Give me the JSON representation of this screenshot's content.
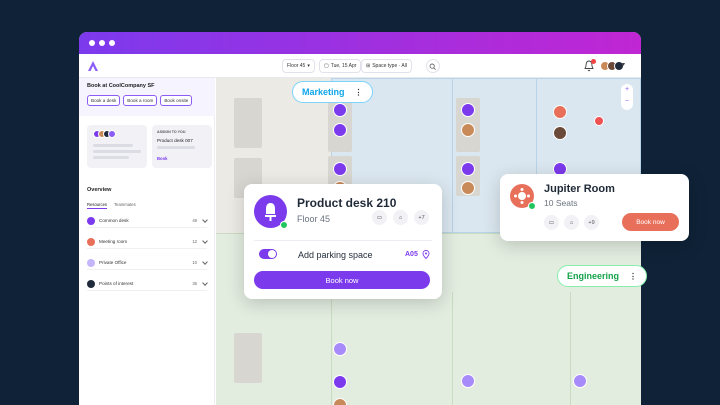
{
  "topbar": {
    "floor_filter": "Floor 45",
    "date_filter": "Tue, 15 Apr",
    "space_filter": "Space type · All"
  },
  "sidebar": {
    "book_title": "Book at CoolCompany SF",
    "buttons": [
      "Book a desk",
      "Book a room",
      "Book onsite"
    ],
    "assign_card": {
      "header": "ASSIGN TO YOU",
      "desk": "Product desk 007",
      "link": "Book"
    },
    "overview_title": "Overview",
    "tabs": [
      "Resources",
      "Teammates"
    ],
    "resources": [
      {
        "label": "Common desk",
        "count": "49",
        "color": "#7c3aed"
      },
      {
        "label": "Meeting room",
        "count": "12",
        "color": "#e8705a"
      },
      {
        "label": "Private Office",
        "count": "10",
        "color": "#c4b5fd"
      },
      {
        "label": "Points of interest",
        "count": "35",
        "color": "#1f2a3a"
      }
    ]
  },
  "map": {
    "zones": {
      "marketing": "Marketing",
      "engineering": "Engineering"
    },
    "zoom_in": "+",
    "zoom_out": "−"
  },
  "desk_card": {
    "title": "Product desk 210",
    "floor": "Floor 45",
    "amenity_more": "+7",
    "parking_label": "Add parking space",
    "parking_code": "A05",
    "parking_enabled": true,
    "book_label": "Book now"
  },
  "room_card": {
    "title": "Jupiter Room",
    "seats": "10 Seats",
    "amenity_more": "+9",
    "book_label": "Book now"
  },
  "colors": {
    "brand_purple": "#7c3aed",
    "room_coral": "#e8705a",
    "marketing_blue": "#0ea5e9",
    "engineering_green": "#16a34a"
  }
}
